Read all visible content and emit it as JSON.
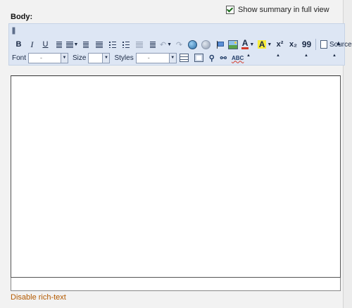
{
  "summary": {
    "label": "Show summary in full view",
    "checked": true
  },
  "body": {
    "label": "Body:"
  },
  "toolbar": {
    "bold": "B",
    "italic": "I",
    "underline": "U",
    "font_color_glyph": "A",
    "bg_color_glyph": "A",
    "superscript": "x²",
    "subscript": "x₂",
    "blockquote": "99",
    "source_label": "Source",
    "font_label": "Font",
    "font_value": "-",
    "size_label": "Size",
    "size_value": "",
    "styles_label": "Styles",
    "styles_value": "-",
    "spell_label": "ABC"
  },
  "footer": {
    "disable_link": "Disable rich-text"
  },
  "colors": {
    "toolbar_bg": "#dde6f4",
    "link": "#b35a00",
    "font_color_bar": "#d43b2a",
    "bg_color_fill": "#f6ec3a"
  }
}
